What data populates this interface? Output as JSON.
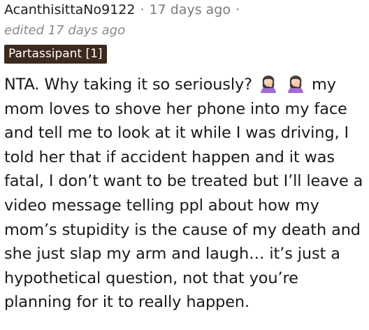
{
  "comment": {
    "author": "AcanthisittaNo9122",
    "separator": "·",
    "timestamp": "17 days ago",
    "edited": "edited 17 days ago",
    "flair": "Partassipant [1]",
    "body_lines": [
      "NTA. Why taking it so seriously?",
      "my",
      "mom loves to shove her phone into my face",
      "and tell me to look at it while I was driving, I",
      "told her that if accident happen and it was",
      "fatal, I don’t want to be treated but I’ll leave a",
      "video message telling ppl about how my",
      "mom’s stupidity is the cause of my death and",
      "she just slap my arm and laugh… it’s just a",
      "hypothetical question, not that you’re",
      "planning for it to really happen."
    ],
    "emojis": [
      "woman-facepalming-emoji",
      "woman-facepalming-emoji"
    ]
  }
}
